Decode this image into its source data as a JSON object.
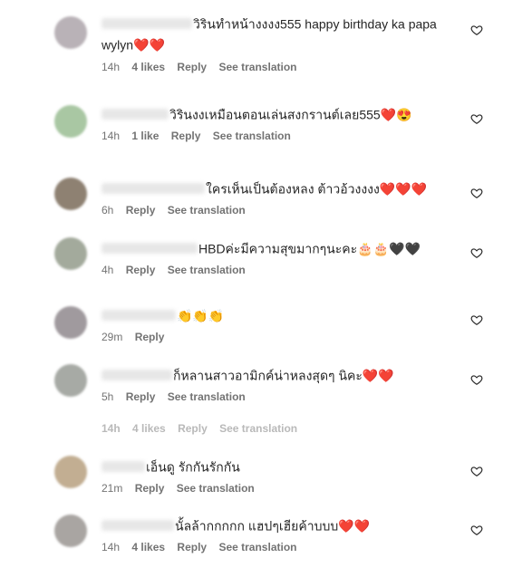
{
  "comments": [
    {
      "avatar_color": "#b9b2b7",
      "text": "วิรินทำหน้างงงง555 happy birthday ka papa wylyn❤️❤️",
      "time": "14h",
      "likes": "4 likes",
      "reply": "Reply",
      "see_translation": "See translation"
    },
    {
      "avatar_color": "#a9c7a3",
      "text": "วิรินงงเหมือนตอนเล่นสงกรานต์เลย555❤️😍",
      "time": "14h",
      "likes": "1 like",
      "reply": "Reply",
      "see_translation": "See translation"
    },
    {
      "avatar_color": "#8e8172",
      "text": "ใครเห็นเป็นต้องหลง ต้าวอ้วงงงง❤️❤️❤️",
      "time": "6h",
      "reply": "Reply",
      "see_translation": "See translation"
    },
    {
      "avatar_color": "#a3aa9c",
      "text": "HBDค่ะมีความสุขมากๆนะคะ🎂🎂🖤🖤",
      "time": "4h",
      "reply": "Reply",
      "see_translation": "See translation"
    },
    {
      "avatar_color": "#a09a9e",
      "text": "👏👏👏",
      "time": "29m",
      "reply": "Reply"
    },
    {
      "avatar_color": "#a7aaa5",
      "text": "ก็หลานสาวอามิกค์น่าหลงสุดๆ นิคะ❤️❤️",
      "time": "5h",
      "reply": "Reply",
      "see_translation": "See translation"
    },
    {
      "avatar_color": "#c2ae92",
      "text": "เอ็นดู รักกันรักกัน",
      "time": "21m",
      "reply": "Reply",
      "see_translation": "See translation"
    },
    {
      "avatar_color": "#a9a5a2",
      "text": "นั้ลล้ากกกกก แฮปๆเฮียค้าบบบ❤️❤️",
      "time": "14h",
      "likes": "4 likes",
      "reply": "Reply",
      "see_translation": "See translation"
    }
  ],
  "ghost_row": {
    "time": "14h",
    "likes": "4 likes",
    "reply": "Reply",
    "see_translation": "See translation"
  },
  "icons": {
    "like": "heart-outline-icon"
  },
  "colors": {
    "text": "#262626",
    "secondary": "#737373"
  }
}
